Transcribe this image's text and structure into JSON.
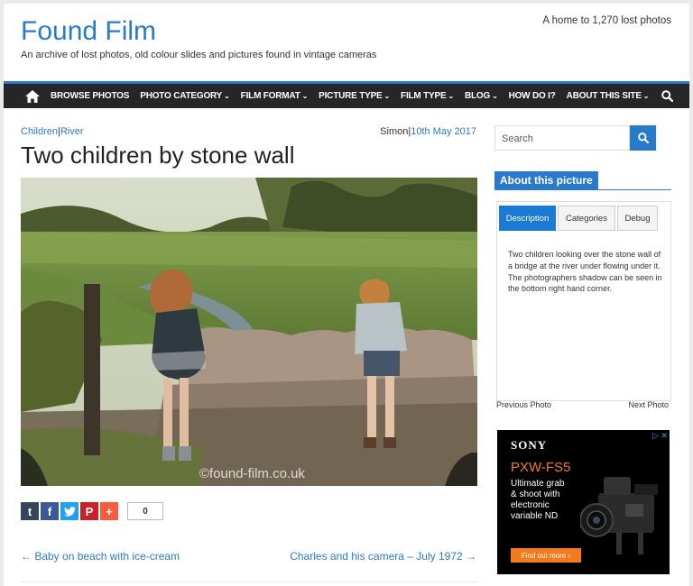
{
  "site": {
    "title": "Found Film",
    "description": "An archive of lost photos, old colour slides and pictures found in vintage cameras",
    "tagline": "A home to 1,270 lost photos"
  },
  "nav": {
    "items": [
      {
        "label": "BROWSE PHOTOS",
        "chevron": false
      },
      {
        "label": "PHOTO CATEGORY",
        "chevron": true
      },
      {
        "label": "FILM FORMAT",
        "chevron": true
      },
      {
        "label": "PICTURE TYPE",
        "chevron": true
      },
      {
        "label": "FILM TYPE",
        "chevron": true
      },
      {
        "label": "BLOG",
        "chevron": true
      },
      {
        "label": "HOW DO I?",
        "chevron": false
      },
      {
        "label": "ABOUT THIS SITE",
        "chevron": true
      }
    ],
    "chevron_glyph": "⌄",
    "home_icon": "home-icon",
    "search_icon": "search-icon"
  },
  "post": {
    "categories": [
      "Children",
      "River"
    ],
    "separator": "|",
    "author": "Simon",
    "date": "10th May 2017",
    "title": "Two children by stone wall",
    "watermark": "©found-film.co.uk",
    "share": {
      "buttons": [
        {
          "name": "tumblr",
          "glyph": "t",
          "color": "#35465c"
        },
        {
          "name": "facebook",
          "glyph": "f",
          "color": "#3b5998"
        },
        {
          "name": "twitter",
          "glyph": "t",
          "color": "#1da1f2"
        },
        {
          "name": "pinterest",
          "glyph": "P",
          "color": "#cb2027"
        },
        {
          "name": "more",
          "glyph": "+",
          "color": "#f65d3c"
        }
      ],
      "count": "0"
    },
    "prev_link": "← Baby on beach with ice-cream",
    "next_link": "Charles and his camera – July 1972 →"
  },
  "sidebar": {
    "search_placeholder": "Search",
    "widget_title": "About this picture",
    "tabs": [
      "Description",
      "Categories",
      "Debug"
    ],
    "active_tab": "Description",
    "description": "Two children looking over the stone wall of a bridge at the river under flowing under it. The photographers shadow can be seen in the bottom right hand corner.",
    "previous_photo": "Previous Photo",
    "next_photo": "Next Photo"
  },
  "ad": {
    "adchoices": "▷ ✕",
    "brand": "SONY",
    "model": "PXW-FS5",
    "copy_lines": [
      "Ultimate grab",
      "& shoot with",
      "electronic",
      "variable ND"
    ],
    "cta": "Find out more ›"
  },
  "colors": {
    "accent": "#2a7acb",
    "nav_bg": "#262626",
    "ad_orange": "#f47a1f"
  }
}
